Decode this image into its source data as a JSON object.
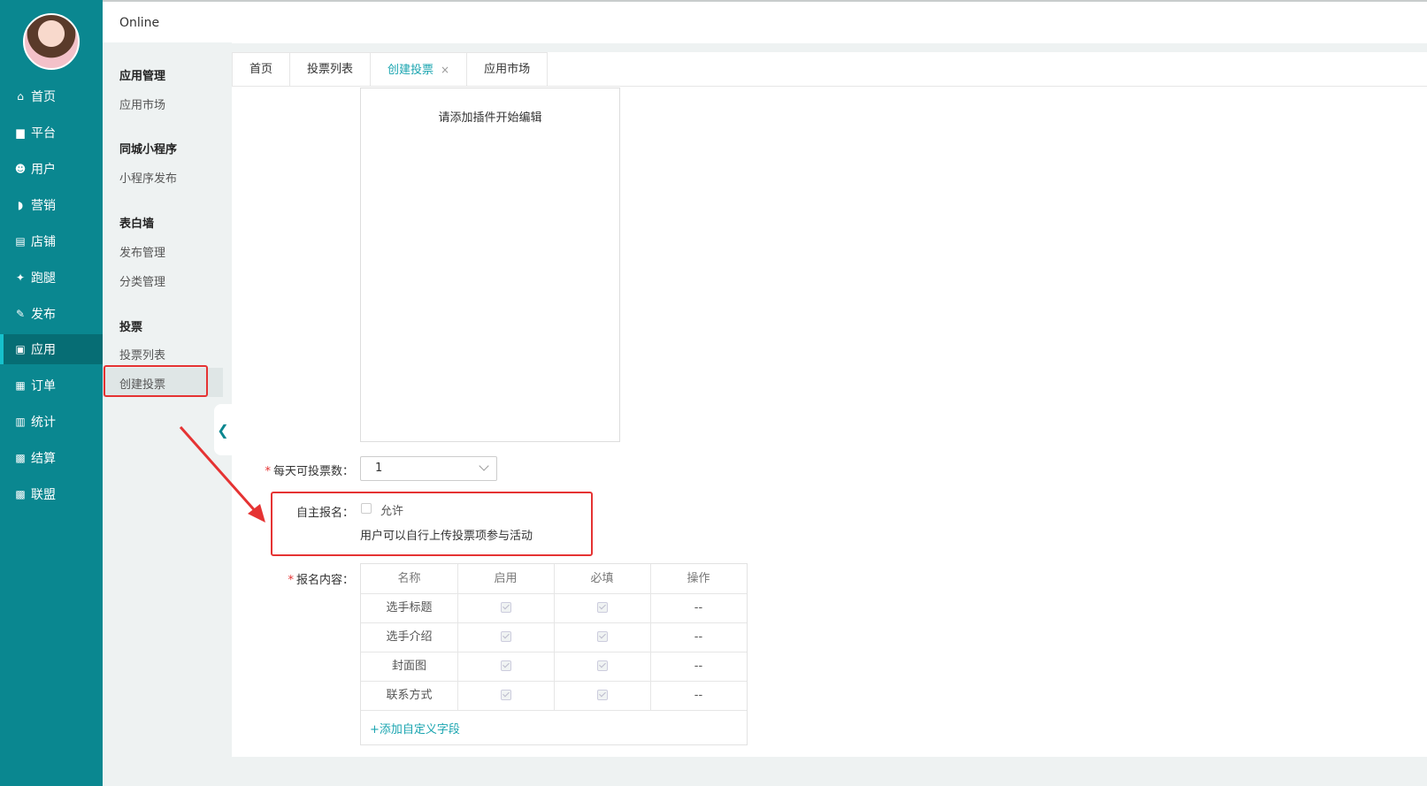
{
  "topbar": {
    "title": "Online"
  },
  "sidebar": {
    "items": [
      {
        "label": "首页",
        "icon": "home-icon",
        "glyph": "⌂"
      },
      {
        "label": "平台",
        "icon": "monitor-icon",
        "glyph": "▆"
      },
      {
        "label": "用户",
        "icon": "users-icon",
        "glyph": "☻"
      },
      {
        "label": "营销",
        "icon": "chat-icon",
        "glyph": "◗"
      },
      {
        "label": "店铺",
        "icon": "store-icon",
        "glyph": "▤"
      },
      {
        "label": "跑腿",
        "icon": "bike-icon",
        "glyph": "✦"
      },
      {
        "label": "发布",
        "icon": "edit-icon",
        "glyph": "✎"
      },
      {
        "label": "应用",
        "icon": "app-icon",
        "glyph": "▣",
        "active": true
      },
      {
        "label": "订单",
        "icon": "clipboard-icon",
        "glyph": "▦"
      },
      {
        "label": "统计",
        "icon": "bar-chart-icon",
        "glyph": "▥"
      },
      {
        "label": "结算",
        "icon": "wallet-icon",
        "glyph": "▩"
      },
      {
        "label": "联盟",
        "icon": "alliance-icon",
        "glyph": "▩"
      }
    ]
  },
  "subnav": {
    "groups": [
      {
        "title": "应用管理",
        "links": [
          "应用市场"
        ]
      },
      {
        "title": "同城小程序",
        "links": [
          "小程序发布"
        ]
      },
      {
        "title": "表白墙",
        "links": [
          "发布管理",
          "分类管理"
        ]
      },
      {
        "title": "投票",
        "links": [
          "投票列表",
          "创建投票"
        ]
      }
    ]
  },
  "tabs": [
    {
      "label": "首页"
    },
    {
      "label": "投票列表"
    },
    {
      "label": "创建投票",
      "active": true,
      "close": "×"
    },
    {
      "label": "应用市场"
    }
  ],
  "form": {
    "preview_text": "请添加插件开始编辑",
    "daily_votes": {
      "label": "每天可投票数：",
      "required_mark": "*",
      "value": "1"
    },
    "self_signup": {
      "label": "自主报名：",
      "checkbox_label": "允许",
      "checked": false,
      "help": "用户可以自行上传投票项参与活动"
    },
    "signup_content": {
      "label": "报名内容：",
      "required_mark": "*",
      "headers": [
        "名称",
        "启用",
        "必填",
        "操作"
      ],
      "rows": [
        {
          "name": "选手标题",
          "enabled": true,
          "required": true,
          "op": "--"
        },
        {
          "name": "选手介绍",
          "enabled": true,
          "required": true,
          "op": "--"
        },
        {
          "name": "封面图",
          "enabled": true,
          "required": true,
          "op": "--"
        },
        {
          "name": "联系方式",
          "enabled": true,
          "required": true,
          "op": "--"
        }
      ],
      "add_link": "+添加自定义字段"
    }
  },
  "colors": {
    "sidebar": "#0a8790",
    "accent": "#1ba5b0",
    "highlight": "#e53333"
  }
}
